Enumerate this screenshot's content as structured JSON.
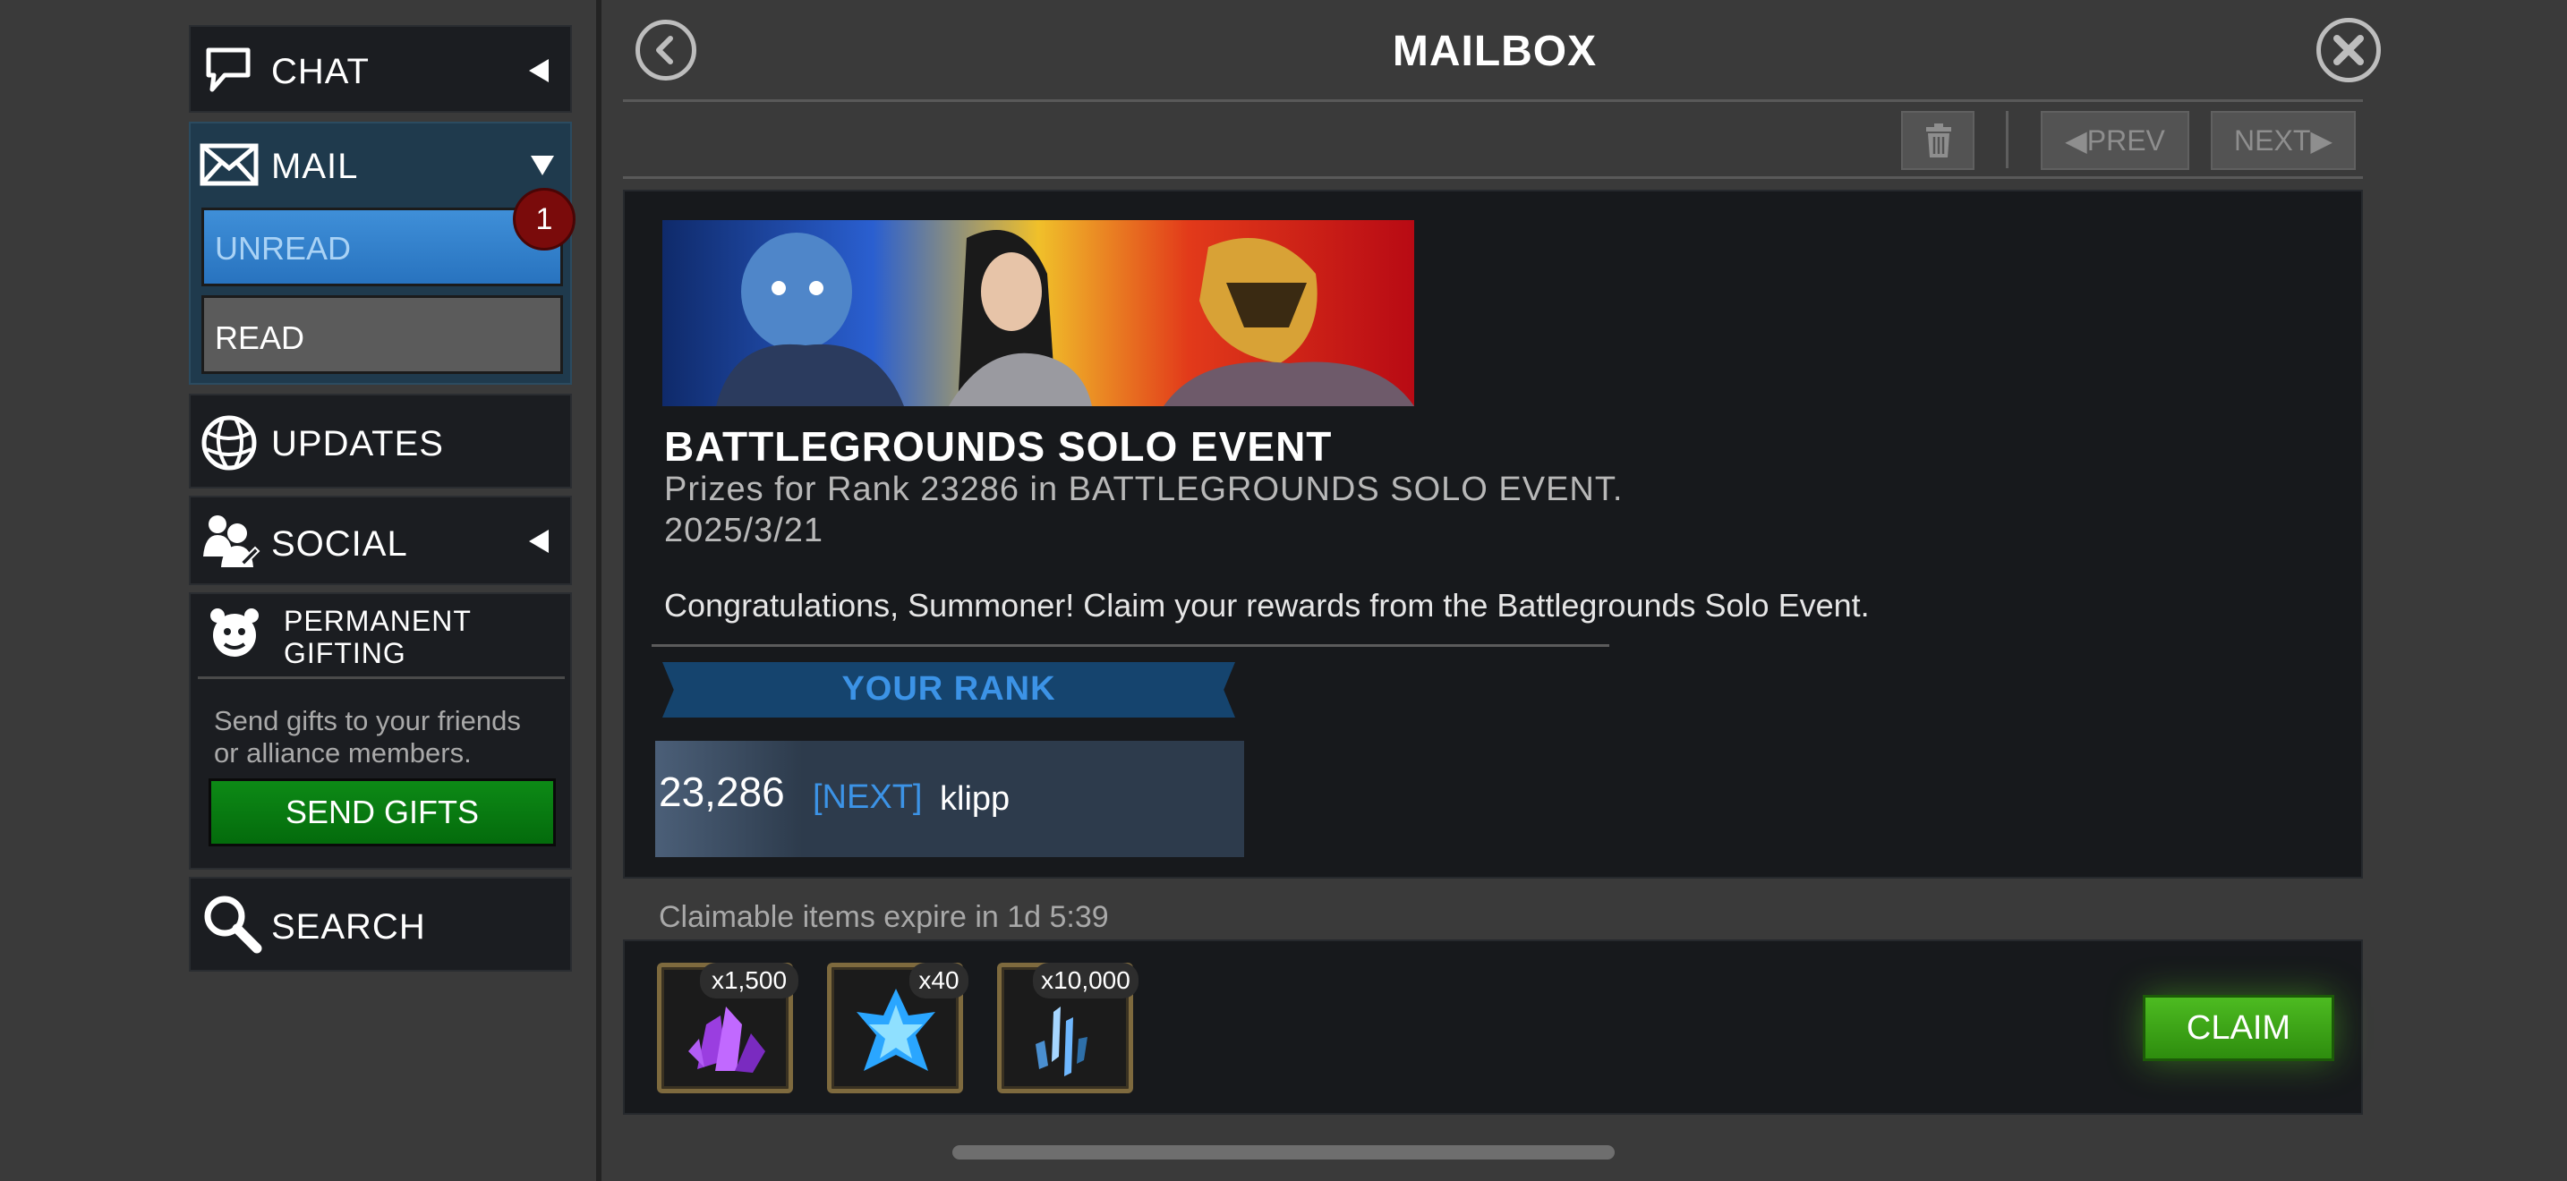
{
  "sidebar": {
    "chat": {
      "label": "CHAT"
    },
    "mail": {
      "label": "MAIL",
      "unread_label": "UNREAD",
      "unread_count": "1",
      "read_label": "READ"
    },
    "updates": {
      "label": "UPDATES"
    },
    "social": {
      "label": "SOCIAL"
    },
    "gifting": {
      "title_line1": "PERMANENT",
      "title_line2": "GIFTING",
      "desc_line1": "Send gifts to your friends",
      "desc_line2": "or alliance members.",
      "button_label": "SEND GIFTS"
    },
    "search": {
      "label": "SEARCH"
    }
  },
  "header": {
    "title": "MAILBOX",
    "prev_label": "PREV",
    "next_label": "NEXT"
  },
  "message": {
    "title": "BATTLEGROUNDS SOLO EVENT",
    "subtitle": "Prizes for Rank 23286 in BATTLEGROUNDS SOLO EVENT.",
    "date": "2025/3/21",
    "body": "Congratulations, Summoner! Claim your rewards from the Battlegrounds Solo Event.",
    "rank_header": "YOUR RANK",
    "rank_value": "23,286",
    "rank_tag": "[NEXT]",
    "player_name": "klipp"
  },
  "rewards": {
    "expire_text": "Claimable items expire in 1d 5:39",
    "items": [
      {
        "name": "purple-crystal-shards-icon",
        "qty": "x1,500"
      },
      {
        "name": "blue-crystal-icon",
        "qty": "x40"
      },
      {
        "name": "crystal-shards-icon",
        "qty": "x10,000"
      }
    ],
    "claim_label": "CLAIM"
  },
  "colors": {
    "accent_blue": "#3c93e6",
    "claim_green": "#4dbb21",
    "gift_green": "#0d8a16",
    "badge_red": "#7a0b0b"
  }
}
